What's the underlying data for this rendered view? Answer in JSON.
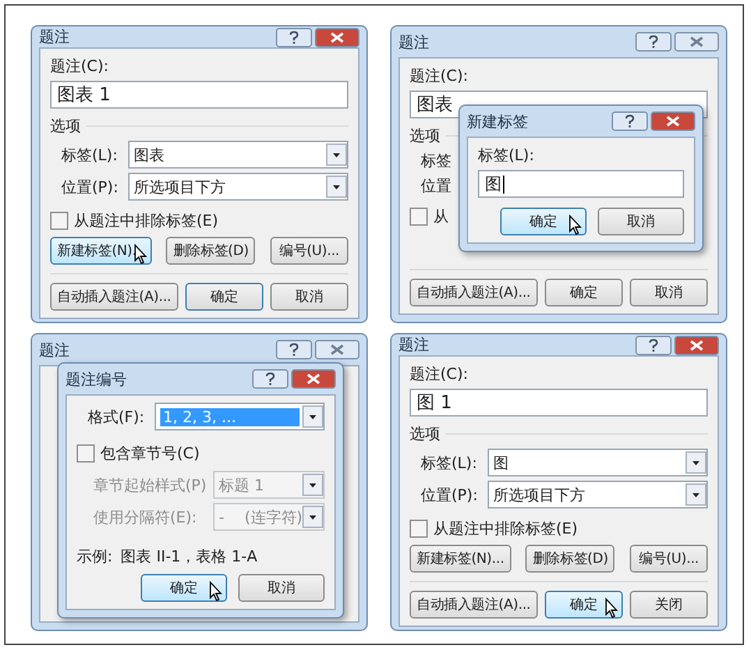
{
  "panels": [
    {
      "dialog": {
        "title": "题注",
        "active": true,
        "caption_label": "题注(C):",
        "caption_value": "图表 1",
        "options_label": "选项",
        "rows": [
          {
            "label": "标签(L):",
            "value": "图表"
          },
          {
            "label": "位置(P):",
            "value": "所选项目下方"
          }
        ],
        "exclude": {
          "label": "从题注中排除标签(E)",
          "checked": false
        },
        "buttons": [
          {
            "label": "新建标签(N)...",
            "hovered": true
          },
          {
            "label": "删除标签(D)",
            "hovered": false
          },
          {
            "label": "编号(U)...",
            "hovered": false
          }
        ],
        "bottom_buttons": [
          {
            "label": "自动插入题注(A)...",
            "default": false,
            "hovered": false
          },
          {
            "label": "确定",
            "default": true,
            "hovered": false
          },
          {
            "label": "取消",
            "default": false,
            "hovered": false
          }
        ]
      }
    },
    {
      "dialog": {
        "title": "题注",
        "active": false,
        "caption_label": "题注(C):",
        "caption_value": "图表",
        "options_label": "选项",
        "rows": [
          {
            "label": "标签"
          },
          {
            "label": "位置"
          }
        ],
        "exclude": {
          "label": "从",
          "checked": false
        },
        "bottom_buttons": [
          {
            "label": "自动插入题注(A)...",
            "default": false,
            "hovered": false
          },
          {
            "label": "确定",
            "default": false,
            "hovered": false
          },
          {
            "label": "取消",
            "default": false,
            "hovered": false
          }
        ]
      },
      "overlay": {
        "kind": "new_label",
        "title": "新建标签",
        "active": true,
        "field_label": "标签(L):",
        "field_value": "图",
        "buttons": [
          {
            "label": "确定",
            "default": true,
            "hovered": true
          },
          {
            "label": "取消",
            "default": false,
            "hovered": false
          }
        ]
      }
    },
    {
      "dialog": {
        "title": "题注",
        "active": false
      },
      "overlay": {
        "kind": "numbering",
        "title": "题注编号",
        "active": true,
        "format_label": "格式(F):",
        "format_value": "1, 2, 3, ...",
        "format_selected": true,
        "chapter": {
          "label": "包含章节号(C)",
          "checked": false
        },
        "rows": [
          {
            "label": "章节起始样式(P)",
            "value": "标题 1",
            "disabled": true
          },
          {
            "label": "使用分隔符(E):",
            "value": "-　 (连字符)",
            "disabled": true
          }
        ],
        "example_label": "示例:",
        "example_value": "图表 II-1，表格 1-A",
        "buttons": [
          {
            "label": "确定",
            "default": true,
            "hovered": true
          },
          {
            "label": "取消",
            "default": false,
            "hovered": false
          }
        ]
      }
    },
    {
      "dialog": {
        "title": "题注",
        "active": true,
        "caption_label": "题注(C):",
        "caption_value": "图 1",
        "options_label": "选项",
        "rows": [
          {
            "label": "标签(L):",
            "value": "图"
          },
          {
            "label": "位置(P):",
            "value": "所选项目下方"
          }
        ],
        "exclude": {
          "label": "从题注中排除标签(E)",
          "checked": false
        },
        "buttons": [
          {
            "label": "新建标签(N)...",
            "hovered": false
          },
          {
            "label": "删除标签(D)",
            "hovered": false
          },
          {
            "label": "编号(U)...",
            "hovered": false
          }
        ],
        "bottom_buttons": [
          {
            "label": "自动插入题注(A)...",
            "default": false,
            "hovered": false
          },
          {
            "label": "确定",
            "default": true,
            "hovered": true
          },
          {
            "label": "关闭",
            "default": false,
            "hovered": false
          }
        ]
      }
    }
  ]
}
